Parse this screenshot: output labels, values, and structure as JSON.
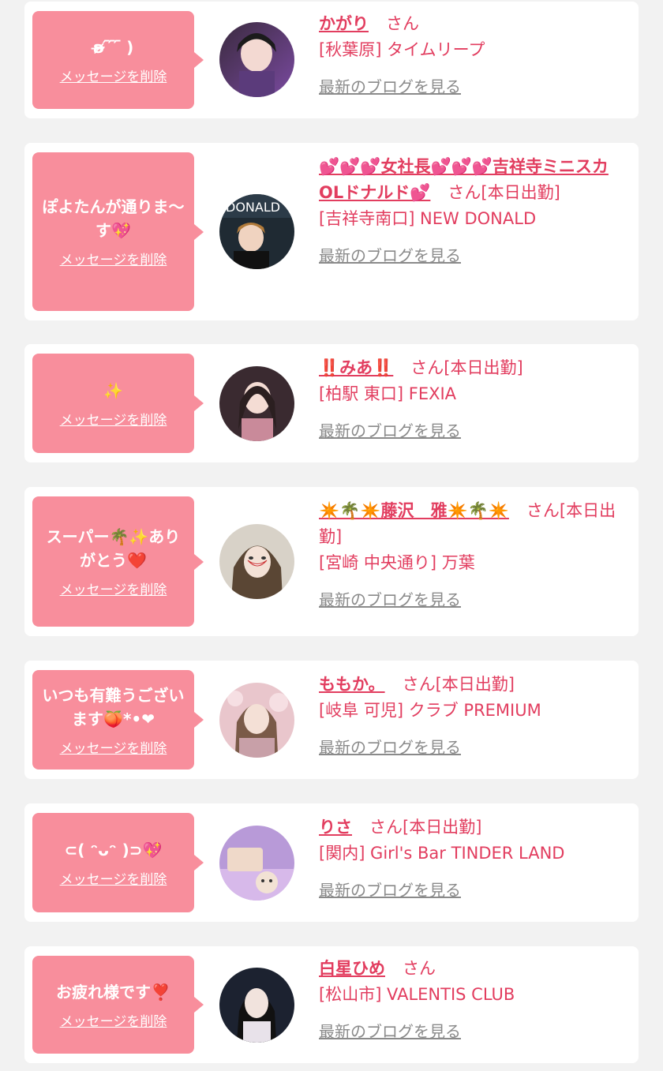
{
  "delete_label": "メッセージを削除",
  "blog_label": "最新のブログを見る",
  "colors": {
    "bubble": "#f88e9c",
    "name": "#e23d5f",
    "link_gray": "#8a8a8a",
    "background": "#f2f2f2"
  },
  "items": [
    {
      "message": "ʚ̴̶̷̷ ᷇ ᷇ ᷇ )",
      "name": "かがり",
      "san": "さん",
      "shop": "[秋葉原] タイムリープ"
    },
    {
      "message": "ぽよたんが通りま〜す💖",
      "name": "💕💕💕女社長💕💕💕吉祥寺ミニスカOLドナルド💕",
      "san": "さん[本日出勤]",
      "shop": "[吉祥寺南口] NEW DONALD"
    },
    {
      "message": "✨",
      "name": "‼️みあ‼️",
      "san": "さん[本日出勤]",
      "shop": "[柏駅 東口] FEXIA"
    },
    {
      "message": "スーパー🌴✨ありがとう❤️",
      "name": "✴️🌴✴️藤沢　雅✴️🌴✴️",
      "san": "さん[本日出勤]",
      "shop": "[宮崎 中央通り] 万葉"
    },
    {
      "message": "いつも有難うございます🍑*•❤",
      "name": "ももか。",
      "san": "さん[本日出勤]",
      "shop": "[岐阜 可児] クラブ PREMIUM"
    },
    {
      "message": "⊂( ᵔᴗᵔ )⊃💖",
      "name": "りさ",
      "san": "さん[本日出勤]",
      "shop": "[関内] Girl's Bar TINDER LAND"
    },
    {
      "message": "お疲れ様です❣️",
      "name": "白星ひめ",
      "san": "さん",
      "shop": "[松山市] VALENTIS CLUB"
    }
  ]
}
